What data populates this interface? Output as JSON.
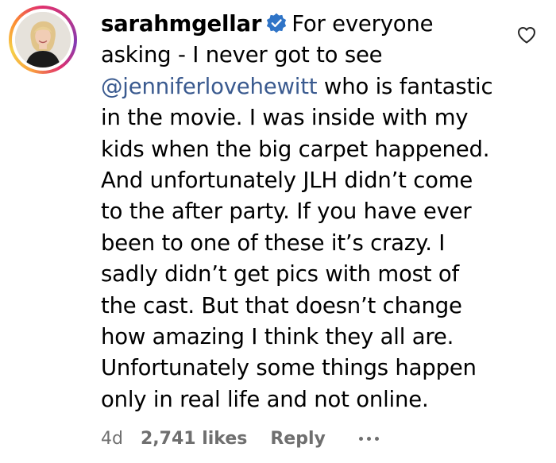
{
  "comment": {
    "username": "sarahmgellar",
    "text_before_mention": "For everyone asking - I never got to see",
    "mention": "@jenniferlovehewitt",
    "text_after_mention": "who is fantastic in the movie. I was inside with my kids when the big carpet happened. And unfortunately JLH didn’t come to the after party. If you have ever been to one of these it’s crazy. I sadly didn’t get pics with most of the cast. But that doesn’t change how amazing I think they all are. Unfortunately some things happen only in real life and not online.",
    "time": "4d",
    "likes": "2,741 likes",
    "reply_label": "Reply"
  },
  "icons": {
    "verified": "verified-badge-icon",
    "like": "heart-icon",
    "more": "more-options-icon"
  },
  "colors": {
    "verified_blue": "#2f74c7",
    "mention": "#3a5a8f",
    "meta_gray": "#6f6f6f"
  }
}
